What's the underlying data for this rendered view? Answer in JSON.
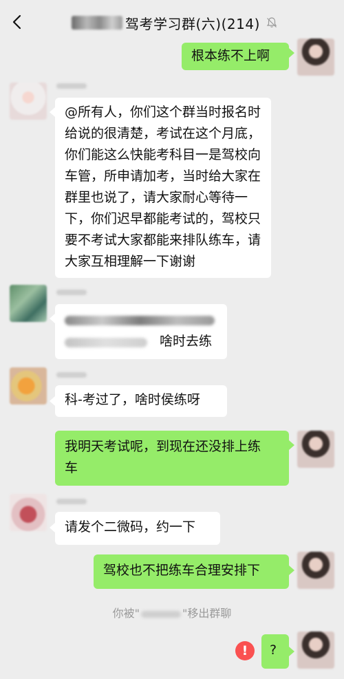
{
  "header": {
    "title": "驾考学习群(六)(214)",
    "back_icon": "chevron-left-icon",
    "mute_icon": "bell-muted-icon"
  },
  "messages": [
    {
      "side": "right",
      "text": "根本练不上啊"
    },
    {
      "side": "left",
      "text": "@所有人，你们这个群当时报名时给说的很清楚，考试在这个月底，你们能这么快能考科目一是驾校向车管，所申请加考，当时给大家在群里也说了，请大家耐心等待一下，你们迟早都能考试的，驾校只要不考试大家都能来排队练车，请大家互相理解一下谢谢"
    },
    {
      "side": "left",
      "text": "啥时去练"
    },
    {
      "side": "left",
      "text": "科-考过了，啥时侯练呀"
    },
    {
      "side": "right",
      "text": "我明天考试呢，到现在还没排上练车"
    },
    {
      "side": "left",
      "text": "请发个二微码，约一下"
    },
    {
      "side": "right",
      "text": "驾校也不把练车合理安排下"
    },
    {
      "side": "right",
      "text": "?"
    }
  ],
  "lines": {
    "m1_l1": "@所有人，你们这个群当时报名时",
    "m1_l2": "给说的很清楚，考试在这个月底，",
    "m1_l3": "你们能这么快能考科目一是驾校向",
    "m1_l4": "车管，所申请加考，当时给大家在",
    "m1_l5": "群里也说了，请大家耐心等待一",
    "m1_l6": "下，你们迟早都能考试的，驾校只",
    "m1_l7": "要不考试大家都能来排队练车，请",
    "m1_l8": "大家互相理解一下谢谢",
    "m4_l1": "我明天考试呢，到现在还没排上练",
    "m4_l2": "车"
  },
  "system_notice": {
    "prefix": "你被\"",
    "suffix": "\"移出群聊"
  },
  "error_badge": "!",
  "colors": {
    "background": "#ededed",
    "bubble_self": "#95ec69",
    "bubble_other": "#ffffff",
    "error": "#fa5151"
  }
}
